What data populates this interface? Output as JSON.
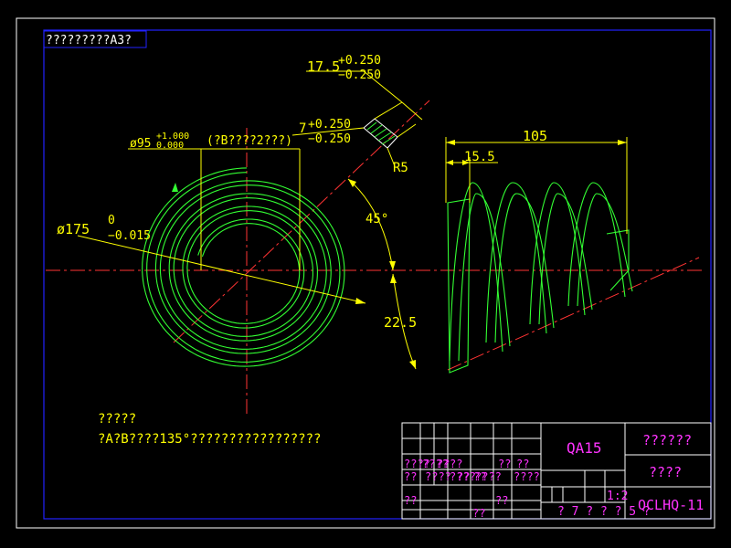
{
  "sheet": {
    "title_note": "?????????A3?",
    "colors": {
      "background": "#000000",
      "frame": "#0000ff",
      "dimension": "#ffff00",
      "centerline": "#ff0000",
      "spring": "#00ff00",
      "table_lines": "#ffffff",
      "table_text": "#ff00ff"
    }
  },
  "dimensions": {
    "thickness_main": "17.5",
    "thickness_tol_upper": "+0.250",
    "thickness_tol_lower": "−0.250",
    "width_main": "7",
    "width_tol_upper": "+0.250",
    "width_tol_lower": "−0.250",
    "inner_dia_main": "ø95",
    "inner_dia_tol_upper": "+1.000",
    "inner_dia_tol_lower": "0.000",
    "inner_dia_note": "(?B????2???)",
    "radius": "R5",
    "angle": "45°",
    "outer_dia_main": "ø175",
    "outer_dia_tol_upper": "0",
    "outer_dia_tol_lower": "−0.015",
    "arc_dim": "22.5",
    "length_total": "105",
    "length_end": "15.5"
  },
  "notes": {
    "heading": "?????",
    "line1": "?A?B????135°?????????????????"
  },
  "title_block": {
    "part_name": "QA15",
    "drawing_no": "QCLHQ-11",
    "material_label": "??????",
    "weight_label": "????",
    "scale": "1:2",
    "sheet_label": "? 7 ? ? ? 5 ?",
    "row_labels": [
      "????",
      "????",
      "??",
      "??",
      "??",
      "??",
      "??"
    ],
    "small_cells": [
      "??",
      "????",
      "????",
      "????",
      "??",
      "??",
      "????",
      "??",
      "??"
    ]
  }
}
